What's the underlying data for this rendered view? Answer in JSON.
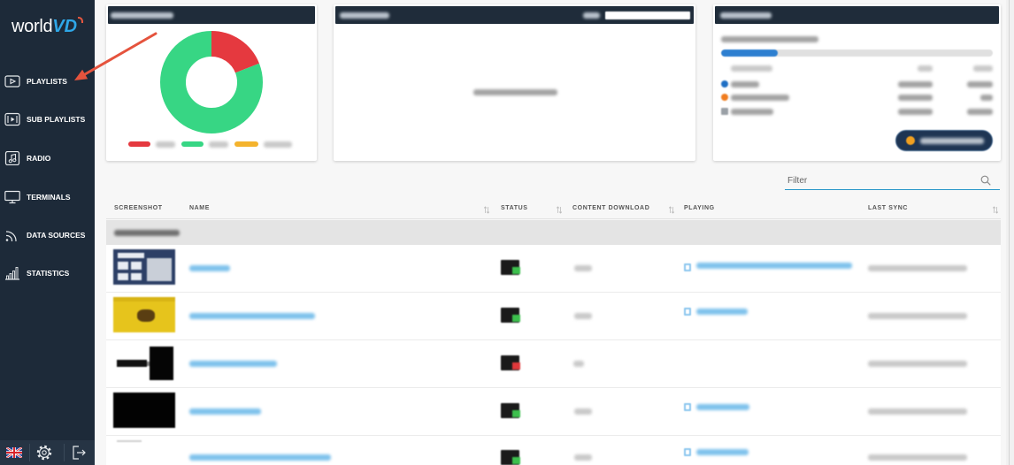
{
  "logo": {
    "part1": "world",
    "part2": "VD"
  },
  "colors": {
    "sidebar_bg": "#1d2a39",
    "accent_blue": "#2f8bd6",
    "annotation_red": "#e5533d",
    "status_ok": "#3cc04d",
    "status_error": "#e0383b"
  },
  "sidebar": {
    "items": [
      {
        "label": "PLAYLISTS",
        "icon": "playlist-icon"
      },
      {
        "label": "SUB PLAYLISTS",
        "icon": "sub-playlist-icon"
      },
      {
        "label": "RADIO",
        "icon": "radio-icon"
      },
      {
        "label": "TERMINALS",
        "icon": "monitor-icon"
      },
      {
        "label": "DATA SOURCES",
        "icon": "rss-icon"
      },
      {
        "label": "STATISTICS",
        "icon": "bar-chart-icon"
      }
    ]
  },
  "footer": {
    "icons": [
      "uk-flag-icon",
      "gear-icon",
      "logout-icon"
    ]
  },
  "cards": {
    "donut": {
      "segments": [
        {
          "color": "#e5393f",
          "fraction": 0.19
        },
        {
          "color": "#37d684",
          "fraction": 0.81
        },
        {
          "color": "#f4b32d",
          "fraction": 0
        }
      ]
    },
    "storage": {
      "used_fraction": 0.21,
      "bar_color": "#2d7fd0",
      "dot_colors": [
        "#1f6fc4",
        "#f07c1e",
        "#9aa0a6"
      ],
      "button_icon_color": "#f0a020"
    }
  },
  "filter": {
    "placeholder": "Filter",
    "icon": "search-icon"
  },
  "table": {
    "columns": [
      {
        "label": "SCREENSHOT",
        "sortable": false
      },
      {
        "label": "NAME",
        "sortable": true
      },
      {
        "label": "STATUS",
        "sortable": true
      },
      {
        "label": "CONTENT DOWNLOAD",
        "sortable": true
      },
      {
        "label": "PLAYING",
        "sortable": false
      },
      {
        "label": "LAST SYNC",
        "sortable": true
      }
    ],
    "rows": [
      {
        "status_color": "#3cc04d"
      },
      {
        "status_color": "#3cc04d"
      },
      {
        "status_color": "#e0383b"
      },
      {
        "status_color": "#3cc04d"
      },
      {
        "status_color": "#3cc04d"
      }
    ]
  }
}
